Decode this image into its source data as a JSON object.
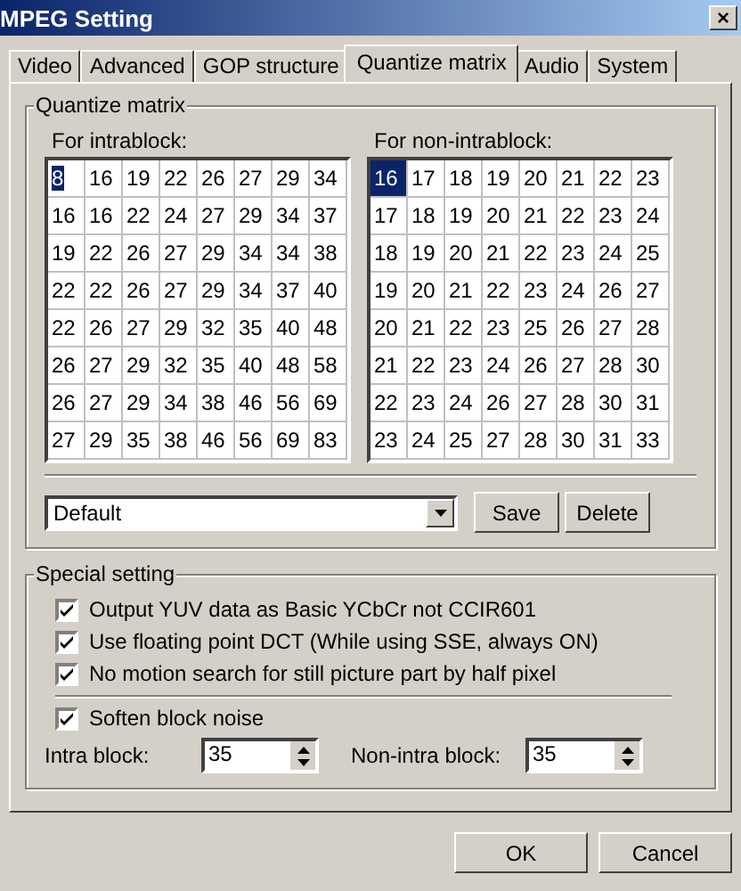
{
  "window": {
    "title": "MPEG Setting",
    "close": "×"
  },
  "tabs": [
    {
      "label": "Video",
      "selected": false
    },
    {
      "label": "Advanced",
      "selected": false
    },
    {
      "label": "GOP structure",
      "selected": false
    },
    {
      "label": "Quantize matrix",
      "selected": true
    },
    {
      "label": "Audio",
      "selected": false
    },
    {
      "label": "System",
      "selected": false
    }
  ],
  "quantize_group": {
    "title": "Quantize matrix",
    "matrices": [
      {
        "label": "For intrablock:",
        "focused": true,
        "rows": [
          [
            {
              "text": "8",
              "selected": true
            },
            {
              "text": "16",
              "selected": false
            },
            {
              "text": "19",
              "selected": false
            },
            {
              "text": "22",
              "selected": false
            },
            {
              "text": "26",
              "selected": false
            },
            {
              "text": "27",
              "selected": false
            },
            {
              "text": "29",
              "selected": false
            },
            {
              "text": "34",
              "selected": false
            }
          ],
          [
            {
              "text": "16",
              "selected": false
            },
            {
              "text": "16",
              "selected": false
            },
            {
              "text": "22",
              "selected": false
            },
            {
              "text": "24",
              "selected": false
            },
            {
              "text": "27",
              "selected": false
            },
            {
              "text": "29",
              "selected": false
            },
            {
              "text": "34",
              "selected": false
            },
            {
              "text": "37",
              "selected": false
            }
          ],
          [
            {
              "text": "19",
              "selected": false
            },
            {
              "text": "22",
              "selected": false
            },
            {
              "text": "26",
              "selected": false
            },
            {
              "text": "27",
              "selected": false
            },
            {
              "text": "29",
              "selected": false
            },
            {
              "text": "34",
              "selected": false
            },
            {
              "text": "34",
              "selected": false
            },
            {
              "text": "38",
              "selected": false
            }
          ],
          [
            {
              "text": "22",
              "selected": false
            },
            {
              "text": "22",
              "selected": false
            },
            {
              "text": "26",
              "selected": false
            },
            {
              "text": "27",
              "selected": false
            },
            {
              "text": "29",
              "selected": false
            },
            {
              "text": "34",
              "selected": false
            },
            {
              "text": "37",
              "selected": false
            },
            {
              "text": "40",
              "selected": false
            }
          ],
          [
            {
              "text": "22",
              "selected": false
            },
            {
              "text": "26",
              "selected": false
            },
            {
              "text": "27",
              "selected": false
            },
            {
              "text": "29",
              "selected": false
            },
            {
              "text": "32",
              "selected": false
            },
            {
              "text": "35",
              "selected": false
            },
            {
              "text": "40",
              "selected": false
            },
            {
              "text": "48",
              "selected": false
            }
          ],
          [
            {
              "text": "26",
              "selected": false
            },
            {
              "text": "27",
              "selected": false
            },
            {
              "text": "29",
              "selected": false
            },
            {
              "text": "32",
              "selected": false
            },
            {
              "text": "35",
              "selected": false
            },
            {
              "text": "40",
              "selected": false
            },
            {
              "text": "48",
              "selected": false
            },
            {
              "text": "58",
              "selected": false
            }
          ],
          [
            {
              "text": "26",
              "selected": false
            },
            {
              "text": "27",
              "selected": false
            },
            {
              "text": "29",
              "selected": false
            },
            {
              "text": "34",
              "selected": false
            },
            {
              "text": "38",
              "selected": false
            },
            {
              "text": "46",
              "selected": false
            },
            {
              "text": "56",
              "selected": false
            },
            {
              "text": "69",
              "selected": false
            }
          ],
          [
            {
              "text": "27",
              "selected": false
            },
            {
              "text": "29",
              "selected": false
            },
            {
              "text": "35",
              "selected": false
            },
            {
              "text": "38",
              "selected": false
            },
            {
              "text": "46",
              "selected": false
            },
            {
              "text": "56",
              "selected": false
            },
            {
              "text": "69",
              "selected": false
            },
            {
              "text": "83",
              "selected": false
            }
          ]
        ]
      },
      {
        "label": "For non-intrablock:",
        "focused": false,
        "rows": [
          [
            {
              "text": "16",
              "selected": true
            },
            {
              "text": "17",
              "selected": false
            },
            {
              "text": "18",
              "selected": false
            },
            {
              "text": "19",
              "selected": false
            },
            {
              "text": "20",
              "selected": false
            },
            {
              "text": "21",
              "selected": false
            },
            {
              "text": "22",
              "selected": false
            },
            {
              "text": "23",
              "selected": false
            }
          ],
          [
            {
              "text": "17",
              "selected": false
            },
            {
              "text": "18",
              "selected": false
            },
            {
              "text": "19",
              "selected": false
            },
            {
              "text": "20",
              "selected": false
            },
            {
              "text": "21",
              "selected": false
            },
            {
              "text": "22",
              "selected": false
            },
            {
              "text": "23",
              "selected": false
            },
            {
              "text": "24",
              "selected": false
            }
          ],
          [
            {
              "text": "18",
              "selected": false
            },
            {
              "text": "19",
              "selected": false
            },
            {
              "text": "20",
              "selected": false
            },
            {
              "text": "21",
              "selected": false
            },
            {
              "text": "22",
              "selected": false
            },
            {
              "text": "23",
              "selected": false
            },
            {
              "text": "24",
              "selected": false
            },
            {
              "text": "25",
              "selected": false
            }
          ],
          [
            {
              "text": "19",
              "selected": false
            },
            {
              "text": "20",
              "selected": false
            },
            {
              "text": "21",
              "selected": false
            },
            {
              "text": "22",
              "selected": false
            },
            {
              "text": "23",
              "selected": false
            },
            {
              "text": "24",
              "selected": false
            },
            {
              "text": "26",
              "selected": false
            },
            {
              "text": "27",
              "selected": false
            }
          ],
          [
            {
              "text": "20",
              "selected": false
            },
            {
              "text": "21",
              "selected": false
            },
            {
              "text": "22",
              "selected": false
            },
            {
              "text": "23",
              "selected": false
            },
            {
              "text": "25",
              "selected": false
            },
            {
              "text": "26",
              "selected": false
            },
            {
              "text": "27",
              "selected": false
            },
            {
              "text": "28",
              "selected": false
            }
          ],
          [
            {
              "text": "21",
              "selected": false
            },
            {
              "text": "22",
              "selected": false
            },
            {
              "text": "23",
              "selected": false
            },
            {
              "text": "24",
              "selected": false
            },
            {
              "text": "26",
              "selected": false
            },
            {
              "text": "27",
              "selected": false
            },
            {
              "text": "28",
              "selected": false
            },
            {
              "text": "30",
              "selected": false
            }
          ],
          [
            {
              "text": "22",
              "selected": false
            },
            {
              "text": "23",
              "selected": false
            },
            {
              "text": "24",
              "selected": false
            },
            {
              "text": "26",
              "selected": false
            },
            {
              "text": "27",
              "selected": false
            },
            {
              "text": "28",
              "selected": false
            },
            {
              "text": "30",
              "selected": false
            },
            {
              "text": "31",
              "selected": false
            }
          ],
          [
            {
              "text": "23",
              "selected": false
            },
            {
              "text": "24",
              "selected": false
            },
            {
              "text": "25",
              "selected": false
            },
            {
              "text": "27",
              "selected": false
            },
            {
              "text": "28",
              "selected": false
            },
            {
              "text": "30",
              "selected": false
            },
            {
              "text": "31",
              "selected": false
            },
            {
              "text": "33",
              "selected": false
            }
          ]
        ]
      }
    ],
    "preset": {
      "value": "Default"
    },
    "buttons": [
      "Save",
      "Delete"
    ]
  },
  "special_group": {
    "title": "Special setting",
    "options": [
      {
        "label": "Output YUV data as Basic YCbCr not CCIR601",
        "checked": true
      },
      {
        "label": "Use floating point DCT (While using SSE, always ON)",
        "checked": true
      },
      {
        "label": "No motion search for still picture part by half pixel",
        "checked": true
      }
    ],
    "soften": {
      "label": "Soften block noise",
      "checked": true
    },
    "spinners": [
      {
        "label": "Intra block:",
        "value": "35"
      },
      {
        "label": "Non-intra block:",
        "value": "35"
      }
    ]
  },
  "buttons": [
    "OK",
    "Cancel"
  ]
}
